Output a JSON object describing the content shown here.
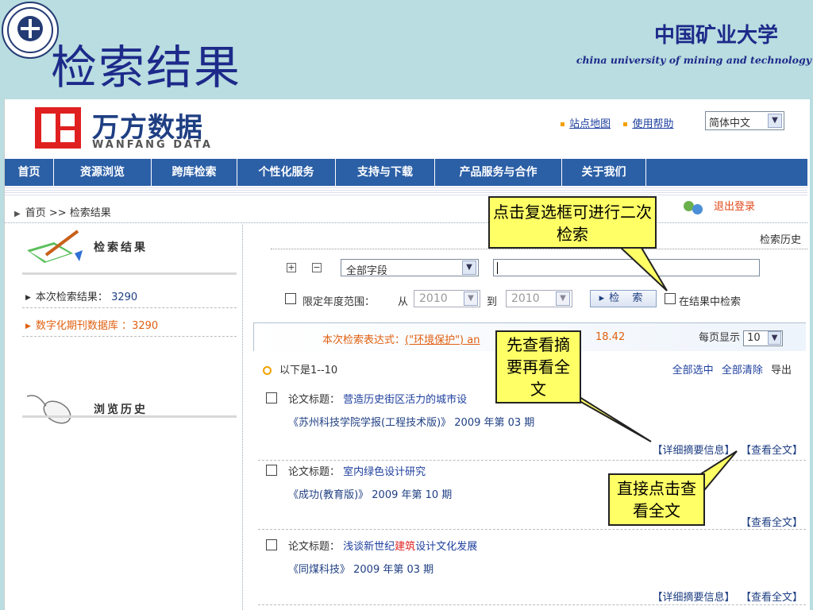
{
  "slide": {
    "title": "检索结果",
    "university_cn": "中国矿业大学",
    "university_en": "china university of mining and technology"
  },
  "site": {
    "brand_cn": "万方数据",
    "brand_en": "WANFANG DATA",
    "top_links": [
      "站点地图",
      "使用帮助"
    ],
    "language": "简体中文"
  },
  "nav": [
    {
      "label": "首页"
    },
    {
      "label": "资源浏览"
    },
    {
      "label": "跨库检索"
    },
    {
      "label": "个性化服务"
    },
    {
      "label": "支持与下载"
    },
    {
      "label": "产品服务与合作"
    },
    {
      "label": "关于我们"
    }
  ],
  "breadcrumb": "首页 >> 检索结果",
  "logout": "退出登录",
  "sidebar": {
    "section1": "检索结果",
    "this_results_label": "本次检索结果：",
    "this_results_count": "3290",
    "db_label": "数字化期刊数据库 ：",
    "db_count": "3290",
    "section2": "浏览历史"
  },
  "search": {
    "history_link": "检索历史",
    "plus": "+",
    "minus": "−",
    "field": "全部字段",
    "query": "",
    "limit_year_label": "限定年度范围：",
    "from_label": "从",
    "from_year": "2010",
    "to_label": "到",
    "to_year": "2010",
    "button": "▸检 索",
    "in_results": "在结果中检索"
  },
  "expression": {
    "label": "本次检索表达式：",
    "query": "(\"环境保护\") an",
    "time": "18.42",
    "per_page_label": "每页显示",
    "per_page": "10"
  },
  "results_range": "以下是1--10",
  "actions": [
    "全部选中",
    "全部清除",
    "导出"
  ],
  "records": [
    {
      "title_label": "论文标题：",
      "title_a": "营造历史街区活力的城市设",
      "title_hl": "",
      "title_b": "",
      "source": "《苏州科技学院学报(工程技术版)》  2009 年第  03 期",
      "links": [
        "【详细摘要信息】",
        "【查看全文】"
      ]
    },
    {
      "title_label": "论文标题：",
      "title_a": "室内绿色设计研究",
      "title_hl": "",
      "title_b": "",
      "source": "《成功(教育版)》  2009 年第  10 期",
      "links": [
        "【查看全文】"
      ]
    },
    {
      "title_label": "论文标题：",
      "title_a": "浅谈新世纪",
      "title_hl": "建筑",
      "title_b": "设计文化发展",
      "source": "《同煤科技》  2009 年第  03 期",
      "links": [
        "【详细摘要信息】",
        "【查看全文】"
      ]
    }
  ],
  "callouts": {
    "checkbox_tip": "点击复选框可进行二次检索",
    "abstract_tip": "先查看摘要再看全文",
    "fulltext_tip": "直接点击查看全文"
  },
  "colors": {
    "slide_bg": "#b9dde0",
    "nav_bg": "#2b5fa6",
    "callout_bg": "#ffff66",
    "title_blue": "#1d2a8a",
    "accent_orange": "#e06010"
  }
}
